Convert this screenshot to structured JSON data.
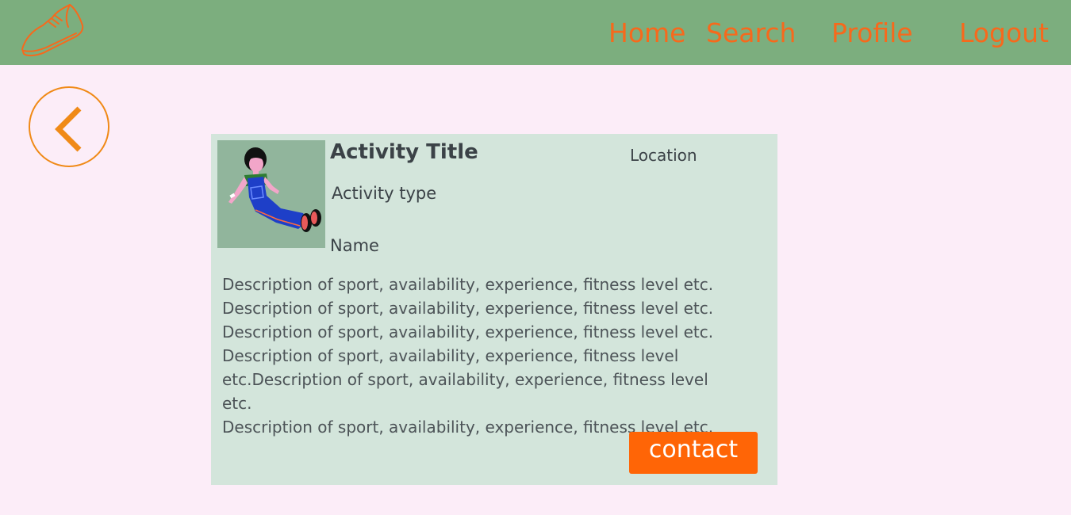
{
  "header": {
    "logo_icon": "sneaker-icon",
    "nav": [
      {
        "label": "Home"
      },
      {
        "label": "Search"
      },
      {
        "label": "Profile"
      },
      {
        "label": "Logout"
      }
    ]
  },
  "back_button": {
    "icon": "chevron-left-icon"
  },
  "card": {
    "avatar_icon": "person-illustration",
    "title": "Activity Title",
    "location": "Location",
    "activity_type": "Activity type",
    "name": "Name",
    "description": "Description of sport, availability, experience, fitness level etc.\nDescription of sport, availability, experience, fitness level etc.\nDescription of sport, availability, experience, fitness level etc.\nDescription of sport, availability, experience, fitness level\netc.Description of sport, availability, experience, fitness level etc.\nDescription of sport, availability, experience, fitness level etc.",
    "contact_label": "contact"
  },
  "colors": {
    "header_bg": "#7cae7e",
    "page_bg": "#fcedf8",
    "accent_orange": "#ff6506",
    "card_bg": "#d3e5db"
  }
}
